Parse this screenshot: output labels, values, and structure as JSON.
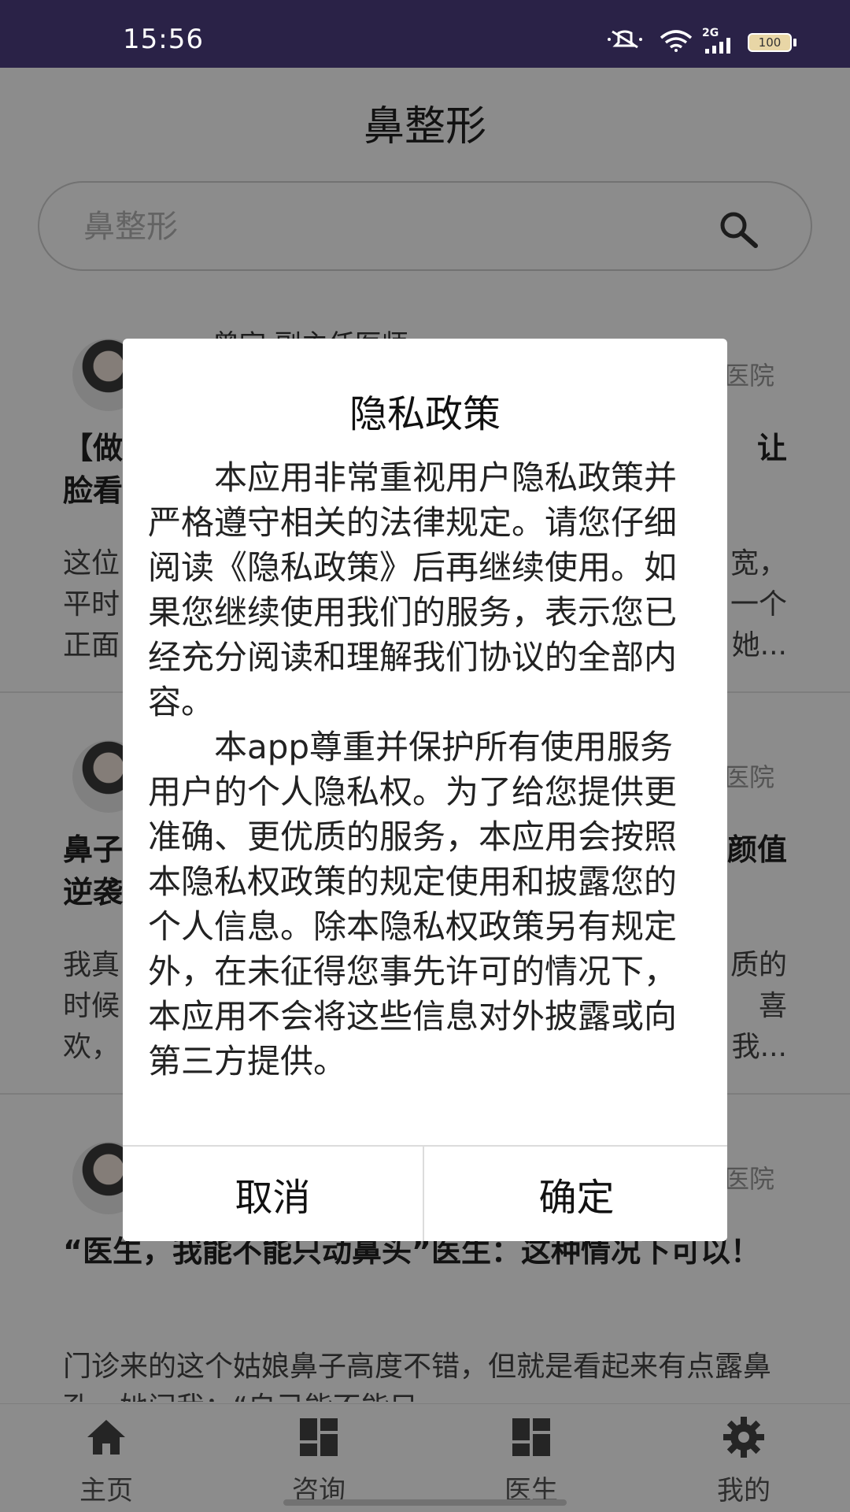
{
  "status_bar": {
    "time": "15:56",
    "network": "2G",
    "battery": "100"
  },
  "header": {
    "title": "鼻整形"
  },
  "search": {
    "placeholder": "鼻整形",
    "icon": "search-icon"
  },
  "feed": {
    "items": [
      {
        "doctor": "曾宇 副主任医师",
        "hospital": "医院",
        "headline": "【做",
        "headline_tail": "让",
        "headline_line2": "脸看",
        "excerpt_line1_head": "这位",
        "excerpt_line1_tail": "宽，",
        "excerpt_line2_head": "平时",
        "excerpt_line2_tail": "一个",
        "excerpt_line3_head": "正面",
        "excerpt_line3_tail": "她..."
      },
      {
        "hospital": "医院",
        "headline_line1_head": "鼻子",
        "headline_line1_tail": "颜值",
        "headline_line2": "逆袭",
        "excerpt_line1_head": "我真",
        "excerpt_line1_tail": "质的",
        "excerpt_line2_head": "时候",
        "excerpt_line2_tail": "喜",
        "excerpt_line3_head": "欢，",
        "excerpt_line3_tail": "我..."
      },
      {
        "hospital": "医院",
        "headline": "“医生，我能不能只动鼻头”医生：这种情况下可以！",
        "excerpt": "门诊来的这个姑娘鼻子高度不错，但就是看起来有点露鼻孔，她问我：“自己能不能只"
      }
    ]
  },
  "tabs": [
    {
      "label": "主页",
      "icon": "home-icon"
    },
    {
      "label": "咨询",
      "icon": "dashboard-icon"
    },
    {
      "label": "医生",
      "icon": "dashboard-icon"
    },
    {
      "label": "我的",
      "icon": "gear-icon"
    }
  ],
  "dialog": {
    "title": "隐私政策",
    "paragraph1": "本应用非常重视用户隐私政策并严格遵守相关的法律规定。请您仔细阅读《隐私政策》后再继续使用。如果您继续使用我们的服务，表示您已经充分阅读和理解我们协议的全部内容。",
    "paragraph2": "本app尊重并保护所有使用服务用户的个人隐私权。为了给您提供更准确、更优质的服务，本应用会按照本隐私权政策的规定使用和披露您的个人信息。除本隐私权政策另有规定外，在未征得您事先许可的情况下，本应用不会将这些信息对外披露或向第三方提供。",
    "cancel_label": "取消",
    "confirm_label": "确定"
  },
  "colors": {
    "status_bar_bg": "#2a2247",
    "overlay": "rgba(0,0,0,0.45)"
  }
}
